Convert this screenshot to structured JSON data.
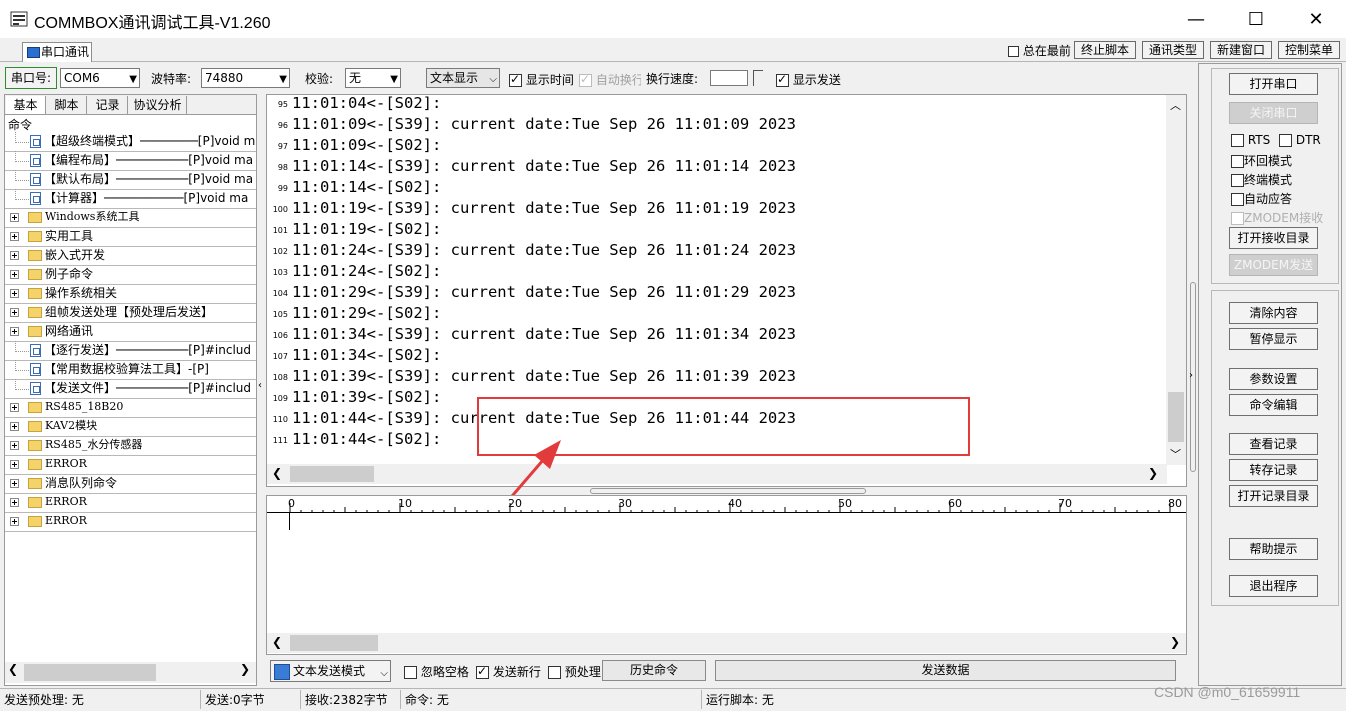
{
  "window": {
    "title": "COMMBOX通讯调试工具-V1.260",
    "minimize_glyph": "—",
    "maximize_glyph": "☐",
    "close_glyph": "✕"
  },
  "tabs": {
    "serial_tab": "串口通讯",
    "always_on_top": "总在最前",
    "stop_script": "终止脚本",
    "comm_type": "通讯类型",
    "new_window": "新建窗口",
    "control_menu": "控制菜单"
  },
  "toolbar": {
    "port_label": "串口号:",
    "port_value": "COM6",
    "baud_label": "波特率:",
    "baud_value": "74880",
    "parity_label": "校验:",
    "parity_value": "无",
    "display_mode": "文本显示",
    "show_time": "显示时间",
    "auto_wrap": "自动换行",
    "wrap_speed_label": "换行速度:",
    "show_send": "显示发送"
  },
  "left_panel": {
    "tabs": [
      "基本",
      "脚本",
      "记录",
      "协议分析"
    ],
    "root_label": "命令",
    "tree": [
      {
        "type": "doc",
        "label": "【超级终端模式】────────[P]void ma"
      },
      {
        "type": "doc",
        "label": "【编程布局】──────────[P]void ma"
      },
      {
        "type": "doc",
        "label": "【默认布局】──────────[P]void ma"
      },
      {
        "type": "doc",
        "label": "【计算器】───────────[P]void ma"
      },
      {
        "type": "folder",
        "label": "Windows系统工具"
      },
      {
        "type": "folder",
        "label": "实用工具"
      },
      {
        "type": "folder",
        "label": "嵌入式开发"
      },
      {
        "type": "folder",
        "label": "例子命令"
      },
      {
        "type": "folder",
        "label": "操作系统相关"
      },
      {
        "type": "folder",
        "label": "组帧发送处理【预处理后发送】"
      },
      {
        "type": "folder",
        "label": "网络通讯"
      },
      {
        "type": "doc",
        "label": "【逐行发送】──────────[P]#includ"
      },
      {
        "type": "doc",
        "label": "【常用数据校验算法工具】-[P]"
      },
      {
        "type": "doc",
        "label": "【发送文件】──────────[P]#includ"
      },
      {
        "type": "folder",
        "label": "RS485_18B20"
      },
      {
        "type": "folder",
        "label": "KAV2模块"
      },
      {
        "type": "folder",
        "label": "RS485_水分传感器"
      },
      {
        "type": "folder",
        "label": "ERROR"
      },
      {
        "type": "folder",
        "label": "消息队列命令"
      },
      {
        "type": "folder",
        "label": "ERROR"
      },
      {
        "type": "folder",
        "label": "ERROR"
      }
    ]
  },
  "receive": {
    "lines": [
      {
        "n": "95",
        "text": "11:01:04<-[S02]:"
      },
      {
        "n": "96",
        "text": "11:01:09<-[S39]: current date:Tue Sep 26 11:01:09 2023"
      },
      {
        "n": "97",
        "text": "11:01:09<-[S02]:"
      },
      {
        "n": "98",
        "text": "11:01:14<-[S39]: current date:Tue Sep 26 11:01:14 2023"
      },
      {
        "n": "99",
        "text": "11:01:14<-[S02]:"
      },
      {
        "n": "100",
        "text": "11:01:19<-[S39]: current date:Tue Sep 26 11:01:19 2023"
      },
      {
        "n": "101",
        "text": "11:01:19<-[S02]:"
      },
      {
        "n": "102",
        "text": "11:01:24<-[S39]: current date:Tue Sep 26 11:01:24 2023"
      },
      {
        "n": "103",
        "text": "11:01:24<-[S02]:"
      },
      {
        "n": "104",
        "text": "11:01:29<-[S39]: current date:Tue Sep 26 11:01:29 2023"
      },
      {
        "n": "105",
        "text": "11:01:29<-[S02]:"
      },
      {
        "n": "106",
        "text": "11:01:34<-[S39]: current date:Tue Sep 26 11:01:34 2023"
      },
      {
        "n": "107",
        "text": "11:01:34<-[S02]:"
      },
      {
        "n": "108",
        "text": "11:01:39<-[S39]: current date:Tue Sep 26 11:01:39 2023"
      },
      {
        "n": "109",
        "text": "11:01:39<-[S02]:"
      },
      {
        "n": "110",
        "text": "11:01:44<-[S39]: current date:Tue Sep 26 11:01:44 2023"
      },
      {
        "n": "111",
        "text": "11:01:44<-[S02]:"
      }
    ]
  },
  "ruler": {
    "labels": [
      "0",
      "10",
      "20",
      "30",
      "40",
      "50",
      "60",
      "70",
      "80"
    ]
  },
  "send_controls": {
    "send_mode": "文本发送模式",
    "ignore_space": "忽略空格",
    "send_newline": "发送新行",
    "preprocess": "预处理",
    "history": "历史命令",
    "send_data": "发送数据"
  },
  "right_panel": {
    "open_port": "打开串口",
    "close_port": "关闭串口",
    "rts": "RTS",
    "dtr": "DTR",
    "loopback": "环回模式",
    "terminal": "终端模式",
    "auto_reply": "自动应答",
    "zmodem_recv": "ZMODEM接收",
    "open_recv_dir": "打开接收目录",
    "zmodem_send": "ZMODEM发送",
    "clear": "清除内容",
    "pause": "暂停显示",
    "params": "参数设置",
    "cmd_edit": "命令编辑",
    "view_log": "查看记录",
    "save_log": "转存记录",
    "open_log_dir": "打开记录目录",
    "help": "帮助提示",
    "exit": "退出程序"
  },
  "status": {
    "preprocess": "发送预处理: 无",
    "sent": "发送:0字节",
    "received": "接收:2382字节",
    "command": "命令: 无",
    "script": "运行脚本: 无",
    "watermark": "CSDN @m0_61659911"
  },
  "colors": {
    "highlight": "#e23b3b",
    "annotation_arrow": "#e23b3b"
  }
}
